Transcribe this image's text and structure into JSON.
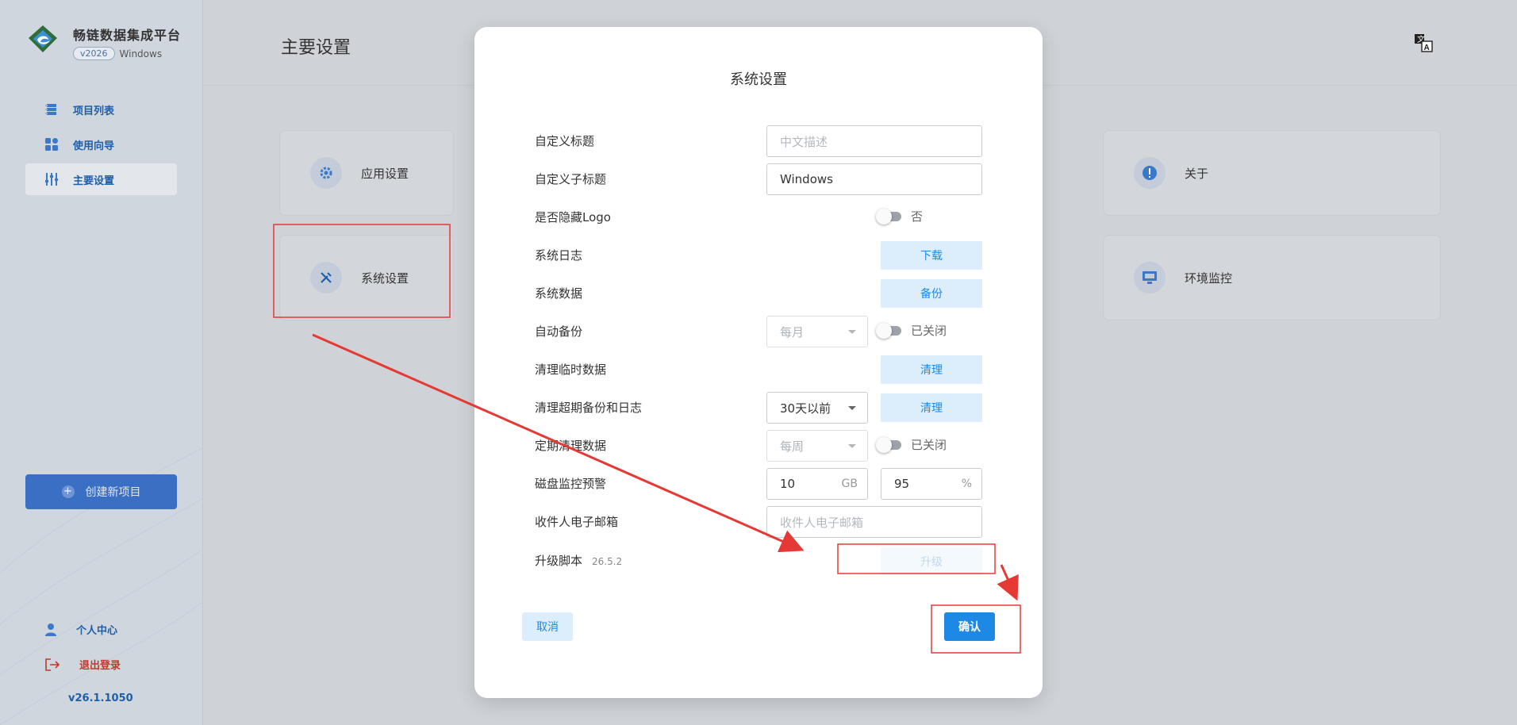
{
  "brand": {
    "name": "畅链数据集成平台",
    "version_badge": "v2026",
    "os": "Windows"
  },
  "sidebar": {
    "items": [
      {
        "label": "项目列表",
        "icon": "list-icon"
      },
      {
        "label": "使用向导",
        "icon": "grid-icon"
      },
      {
        "label": "主要设置",
        "icon": "sliders-icon",
        "active": true
      }
    ],
    "create_button": "创建新项目",
    "profile": "个人中心",
    "logout": "退出登录",
    "app_version": "v26.1.1050"
  },
  "main": {
    "title": "主要设置",
    "cards": [
      {
        "label": "应用设置",
        "icon": "gear-icon"
      },
      {
        "label": "系统设置",
        "icon": "tools-icon"
      },
      {
        "label": "关于",
        "icon": "info-icon"
      },
      {
        "label": "环境监控",
        "icon": "monitor-icon"
      }
    ]
  },
  "dialog": {
    "title": "系统设置",
    "custom_title": {
      "label": "自定义标题",
      "placeholder": "中文描述"
    },
    "custom_subtitle": {
      "label": "自定义子标题",
      "value": "Windows"
    },
    "hide_logo": {
      "label": "是否隐藏Logo",
      "state": "否"
    },
    "system_log": {
      "label": "系统日志",
      "button": "下载"
    },
    "system_data": {
      "label": "系统数据",
      "button": "备份"
    },
    "auto_backup": {
      "label": "自动备份",
      "select": "每月",
      "state": "已关闭"
    },
    "clean_temp": {
      "label": "清理临时数据",
      "button": "清理"
    },
    "clean_expired": {
      "label": "清理超期备份和日志",
      "select": "30天以前",
      "button": "清理"
    },
    "periodic_clean": {
      "label": "定期清理数据",
      "select": "每周",
      "state": "已关闭"
    },
    "disk_alert": {
      "label": "磁盘监控预警",
      "gb_value": "10",
      "gb_unit": "GB",
      "pct_value": "95",
      "pct_unit": "%"
    },
    "recipient_email": {
      "label": "收件人电子邮箱",
      "placeholder": "收件人电子邮箱"
    },
    "upgrade_script": {
      "label": "升级脚本",
      "version": "26.5.2",
      "button": "升级"
    },
    "cancel": "取消",
    "confirm": "确认"
  },
  "colors": {
    "accent": "#1e88e5",
    "annotation": "#e53935",
    "nav_text": "#1f5fa8"
  }
}
